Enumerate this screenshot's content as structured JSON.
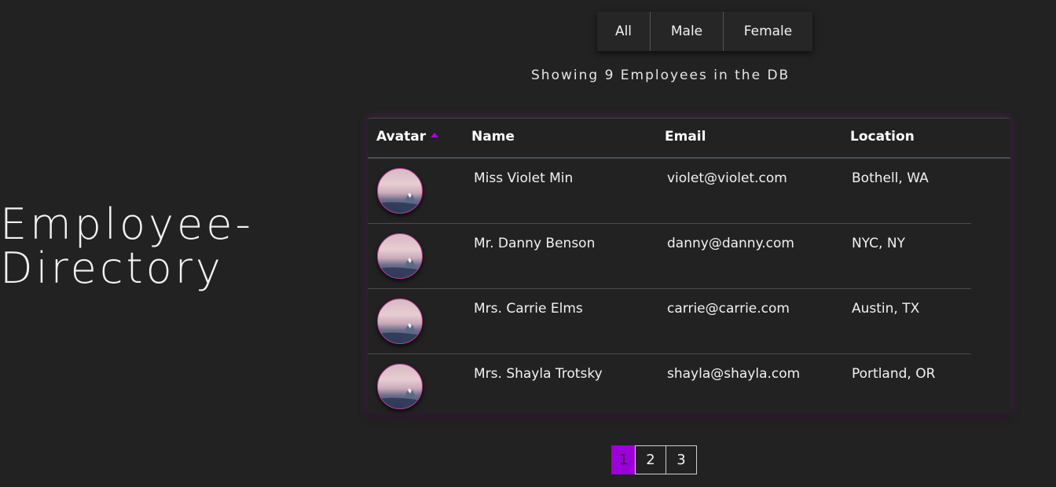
{
  "app": {
    "title_line1": "Employee-",
    "title_line2": "Directory"
  },
  "filters": {
    "all_label": "All",
    "male_label": "Male",
    "female_label": "Female"
  },
  "status": {
    "text": "Showing 9 Employees in the DB"
  },
  "table": {
    "columns": {
      "avatar": "Avatar",
      "name": "Name",
      "email": "Email",
      "location": "Location"
    },
    "sort_accent": "#b300e6",
    "rows": [
      {
        "name": "Miss Violet Min",
        "email": "violet@violet.com",
        "location": "Bothell, WA"
      },
      {
        "name": "Mr. Danny Benson",
        "email": "danny@danny.com",
        "location": "NYC, NY"
      },
      {
        "name": "Mrs. Carrie Elms",
        "email": "carrie@carrie.com",
        "location": "Austin, TX"
      },
      {
        "name": "Mrs. Shayla Trotsky",
        "email": "shayla@shayla.com",
        "location": "Portland, OR"
      }
    ]
  },
  "pagination": {
    "pages": [
      "1",
      "2",
      "3"
    ],
    "current": "1",
    "active_color": "#9b00d9"
  }
}
